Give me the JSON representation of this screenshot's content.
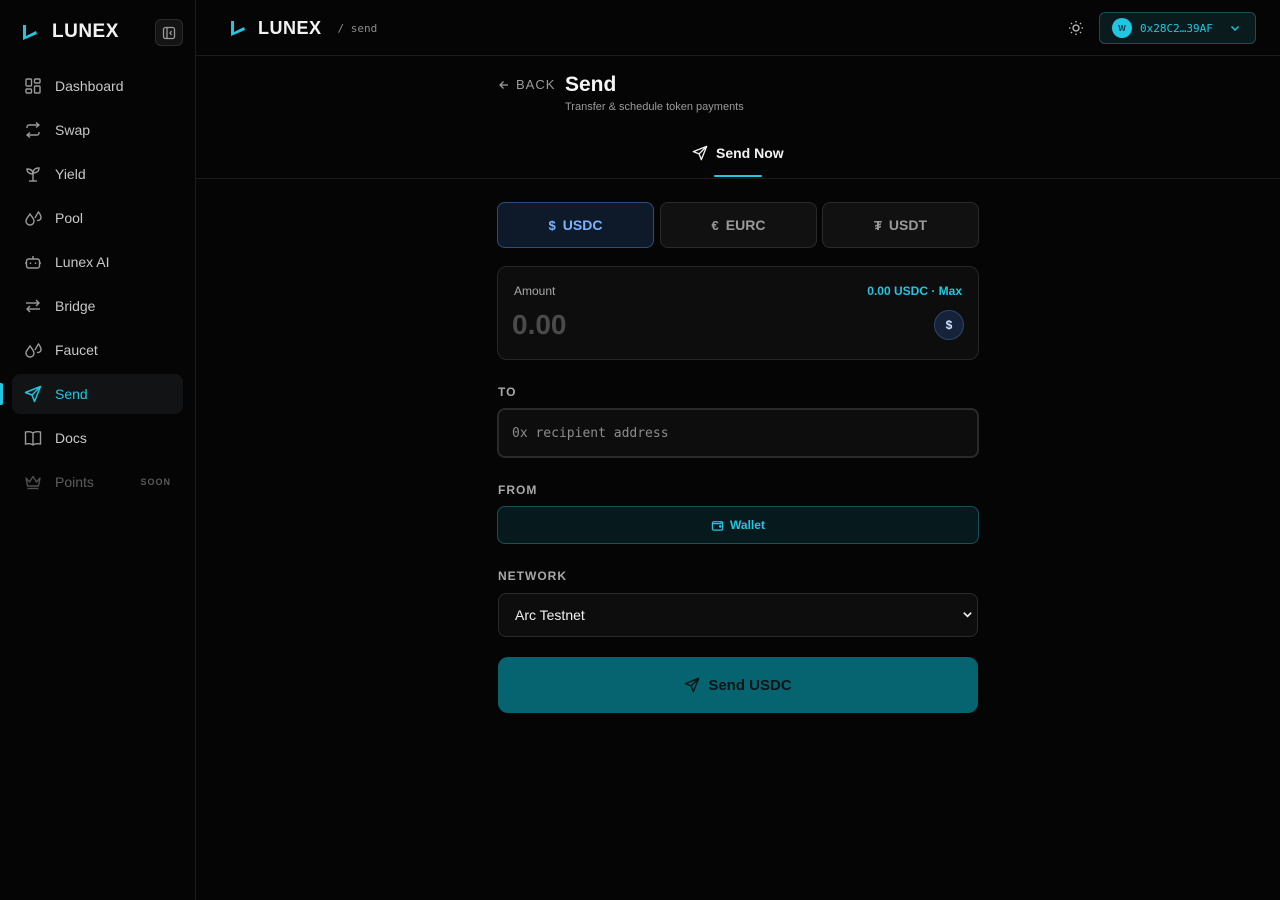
{
  "app": {
    "brand": "LUNEX",
    "breadcrumb": "/ send"
  },
  "sidebar": {
    "items": [
      {
        "label": "Dashboard",
        "icon": "dashboard-icon"
      },
      {
        "label": "Swap",
        "icon": "swap-icon"
      },
      {
        "label": "Yield",
        "icon": "sprout-icon"
      },
      {
        "label": "Pool",
        "icon": "droplets-icon"
      },
      {
        "label": "Lunex AI",
        "icon": "bot-icon"
      },
      {
        "label": "Bridge",
        "icon": "bridge-icon"
      },
      {
        "label": "Faucet",
        "icon": "droplets-icon"
      },
      {
        "label": "Send",
        "icon": "send-icon",
        "active": true
      },
      {
        "label": "Docs",
        "icon": "book-icon"
      },
      {
        "label": "Points",
        "icon": "crown-icon",
        "badge": "SOON",
        "disabled": true
      }
    ]
  },
  "header": {
    "wallet_address": "0x28C2…39AF",
    "wallet_avatar": "W"
  },
  "page": {
    "back_label": "BACK",
    "title": "Send",
    "subtitle": "Transfer & schedule token payments",
    "tab_label": "Send Now"
  },
  "tokens": [
    {
      "symbol": "$",
      "label": "USDC",
      "active": true
    },
    {
      "symbol": "€",
      "label": "EURC"
    },
    {
      "symbol": "₮",
      "label": "USDT"
    }
  ],
  "amount": {
    "label": "Amount",
    "balance": "0.00 USDC · Max",
    "placeholder": "0.00",
    "coin_symbol": "$"
  },
  "to": {
    "label": "TO",
    "placeholder": "0x recipient address"
  },
  "from": {
    "label": "FROM",
    "option": "Wallet"
  },
  "network": {
    "label": "NETWORK",
    "selected": "Arc Testnet"
  },
  "send_button": "Send USDC",
  "colors": {
    "accent": "#22c6e0",
    "send_button": "#056470",
    "active_token": "#78b4ff"
  }
}
